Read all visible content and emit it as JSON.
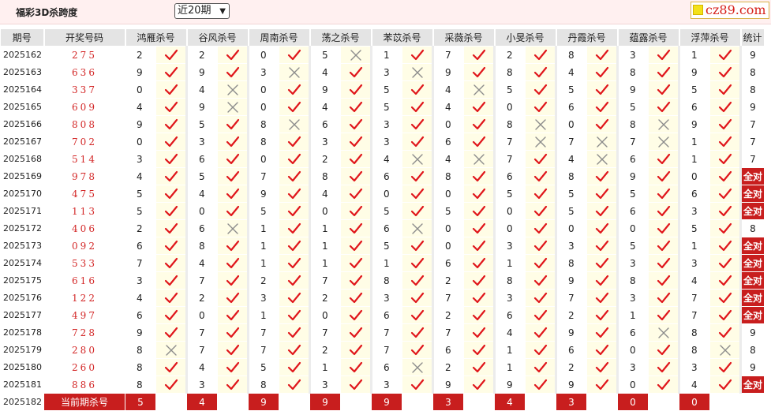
{
  "header": {
    "title": "福彩3D杀跨度",
    "period_selected": "近20期",
    "logo_text": "cz89.com"
  },
  "columns": [
    "期号",
    "开奖号码",
    "鸿雁杀号",
    "谷风杀号",
    "周南杀号",
    "荡之杀号",
    "苯苡杀号",
    "采薇杀号",
    "小旻杀号",
    "丹霞杀号",
    "蕴露杀号",
    "浮萍杀号",
    "统计"
  ],
  "rows": [
    {
      "issue": "2025162",
      "number": "275",
      "picks": [
        2,
        2,
        0,
        5,
        1,
        7,
        2,
        8,
        3,
        1
      ],
      "hits": [
        1,
        1,
        1,
        0,
        1,
        1,
        1,
        1,
        1,
        1
      ],
      "stat": "9"
    },
    {
      "issue": "2025163",
      "number": "636",
      "picks": [
        9,
        9,
        3,
        4,
        3,
        9,
        8,
        4,
        8,
        9
      ],
      "hits": [
        1,
        1,
        0,
        1,
        0,
        1,
        1,
        1,
        1,
        1
      ],
      "stat": "8"
    },
    {
      "issue": "2025164",
      "number": "337",
      "picks": [
        0,
        4,
        0,
        9,
        5,
        4,
        5,
        5,
        9,
        5
      ],
      "hits": [
        1,
        0,
        1,
        1,
        1,
        0,
        1,
        1,
        1,
        1
      ],
      "stat": "8"
    },
    {
      "issue": "2025165",
      "number": "609",
      "picks": [
        4,
        9,
        0,
        4,
        5,
        4,
        0,
        6,
        5,
        6
      ],
      "hits": [
        1,
        0,
        1,
        1,
        1,
        1,
        1,
        1,
        1,
        1
      ],
      "stat": "9"
    },
    {
      "issue": "2025166",
      "number": "808",
      "picks": [
        9,
        5,
        8,
        6,
        3,
        0,
        8,
        0,
        8,
        9
      ],
      "hits": [
        1,
        1,
        0,
        1,
        1,
        1,
        0,
        1,
        0,
        1
      ],
      "stat": "7"
    },
    {
      "issue": "2025167",
      "number": "702",
      "picks": [
        0,
        3,
        8,
        3,
        3,
        6,
        7,
        7,
        7,
        1
      ],
      "hits": [
        1,
        1,
        1,
        1,
        1,
        1,
        0,
        0,
        0,
        1
      ],
      "stat": "7"
    },
    {
      "issue": "2025168",
      "number": "514",
      "picks": [
        3,
        6,
        0,
        2,
        4,
        4,
        7,
        4,
        6,
        1
      ],
      "hits": [
        1,
        1,
        1,
        1,
        0,
        0,
        1,
        0,
        1,
        1
      ],
      "stat": "7"
    },
    {
      "issue": "2025169",
      "number": "978",
      "picks": [
        4,
        5,
        7,
        8,
        6,
        8,
        6,
        8,
        9,
        0
      ],
      "hits": [
        1,
        1,
        1,
        1,
        1,
        1,
        1,
        1,
        1,
        1
      ],
      "stat": "全对"
    },
    {
      "issue": "2025170",
      "number": "475",
      "picks": [
        5,
        4,
        9,
        4,
        0,
        0,
        5,
        5,
        5,
        6
      ],
      "hits": [
        1,
        1,
        1,
        1,
        1,
        1,
        1,
        1,
        1,
        1
      ],
      "stat": "全对"
    },
    {
      "issue": "2025171",
      "number": "113",
      "picks": [
        5,
        0,
        5,
        0,
        5,
        5,
        0,
        5,
        6,
        3
      ],
      "hits": [
        1,
        1,
        1,
        1,
        1,
        1,
        1,
        1,
        1,
        1
      ],
      "stat": "全对"
    },
    {
      "issue": "2025172",
      "number": "406",
      "picks": [
        2,
        6,
        1,
        1,
        6,
        0,
        0,
        0,
        0,
        5
      ],
      "hits": [
        1,
        0,
        1,
        1,
        0,
        1,
        1,
        1,
        1,
        1
      ],
      "stat": "8"
    },
    {
      "issue": "2025173",
      "number": "092",
      "picks": [
        6,
        8,
        1,
        1,
        5,
        0,
        3,
        3,
        5,
        1
      ],
      "hits": [
        1,
        1,
        1,
        1,
        1,
        1,
        1,
        1,
        1,
        1
      ],
      "stat": "全对"
    },
    {
      "issue": "2025174",
      "number": "533",
      "picks": [
        7,
        4,
        1,
        1,
        1,
        6,
        1,
        8,
        3,
        3
      ],
      "hits": [
        1,
        1,
        1,
        1,
        1,
        1,
        1,
        1,
        1,
        1
      ],
      "stat": "全对"
    },
    {
      "issue": "2025175",
      "number": "616",
      "picks": [
        3,
        7,
        2,
        7,
        8,
        2,
        8,
        9,
        8,
        4
      ],
      "hits": [
        1,
        1,
        1,
        1,
        1,
        1,
        1,
        1,
        1,
        1
      ],
      "stat": "全对"
    },
    {
      "issue": "2025176",
      "number": "122",
      "picks": [
        4,
        2,
        3,
        2,
        3,
        7,
        3,
        7,
        3,
        7
      ],
      "hits": [
        1,
        1,
        1,
        1,
        1,
        1,
        1,
        1,
        1,
        1
      ],
      "stat": "全对"
    },
    {
      "issue": "2025177",
      "number": "497",
      "picks": [
        6,
        0,
        1,
        0,
        6,
        2,
        6,
        2,
        1,
        7
      ],
      "hits": [
        1,
        1,
        1,
        1,
        1,
        1,
        1,
        1,
        1,
        1
      ],
      "stat": "全对"
    },
    {
      "issue": "2025178",
      "number": "728",
      "picks": [
        9,
        7,
        7,
        7,
        7,
        7,
        4,
        9,
        6,
        8
      ],
      "hits": [
        1,
        1,
        1,
        1,
        1,
        1,
        1,
        1,
        0,
        1
      ],
      "stat": "9"
    },
    {
      "issue": "2025179",
      "number": "280",
      "picks": [
        8,
        7,
        7,
        2,
        7,
        6,
        1,
        6,
        0,
        8
      ],
      "hits": [
        0,
        1,
        1,
        1,
        1,
        1,
        1,
        1,
        1,
        0
      ],
      "stat": "8"
    },
    {
      "issue": "2025180",
      "number": "260",
      "picks": [
        8,
        4,
        5,
        1,
        6,
        2,
        1,
        2,
        3,
        3
      ],
      "hits": [
        1,
        1,
        1,
        1,
        0,
        1,
        1,
        1,
        1,
        1
      ],
      "stat": "9"
    },
    {
      "issue": "2025181",
      "number": "886",
      "picks": [
        8,
        3,
        8,
        3,
        3,
        9,
        9,
        9,
        0,
        4
      ],
      "hits": [
        1,
        1,
        1,
        1,
        1,
        1,
        1,
        1,
        1,
        1
      ],
      "stat": "全对"
    }
  ],
  "current": {
    "issue": "2025182",
    "label": "当前期杀号",
    "picks": [
      5,
      4,
      9,
      9,
      9,
      3,
      4,
      3,
      0,
      0
    ]
  }
}
